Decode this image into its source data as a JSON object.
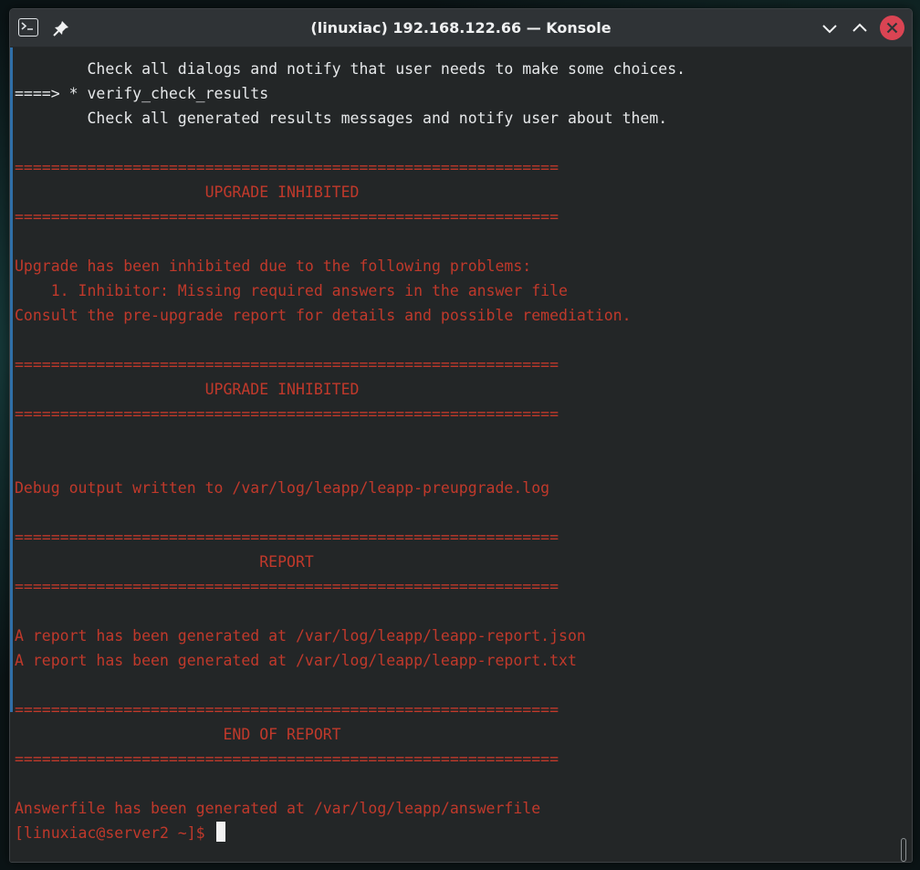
{
  "window": {
    "title": "(linuxiac) 192.168.122.66 — Konsole"
  },
  "icons": {
    "app": "konsole-terminal-icon",
    "pin": "pin-icon",
    "minimize": "chevron-down-icon",
    "maximize": "chevron-up-icon",
    "close": "close-icon"
  },
  "colors": {
    "background": "#232627",
    "text": "#e6e8ea",
    "inhibited_red": "#c0392b",
    "close_button": "#da4453",
    "focus_accent": "#2f6fa8"
  },
  "terminal": {
    "lines": [
      "        Check all dialogs and notify that user needs to make some choices.",
      "====> * verify_check_results",
      "        Check all generated results messages and notify user about them.",
      "",
      "============================================================",
      "                     UPGRADE INHIBITED",
      "============================================================",
      "",
      "Upgrade has been inhibited due to the following problems:",
      "    1. Inhibitor: Missing required answers in the answer file",
      "Consult the pre-upgrade report for details and possible remediation.",
      "",
      "============================================================",
      "                     UPGRADE INHIBITED",
      "============================================================",
      "",
      "",
      "Debug output written to /var/log/leapp/leapp-preupgrade.log",
      "",
      "============================================================",
      "                           REPORT",
      "============================================================",
      "",
      "A report has been generated at /var/log/leapp/leapp-report.json",
      "A report has been generated at /var/log/leapp/leapp-report.txt",
      "",
      "============================================================",
      "                       END OF REPORT",
      "============================================================",
      "",
      "Answerfile has been generated at /var/log/leapp/answerfile"
    ],
    "prompt": "[linuxiac@server2 ~]$ "
  }
}
